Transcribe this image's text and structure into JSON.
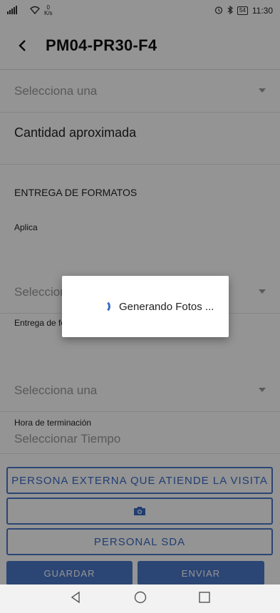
{
  "status_bar": {
    "speed_value": "0",
    "speed_unit": "K/s",
    "battery": "54",
    "time": "11:30"
  },
  "header": {
    "title": "PM04-PR30-F4"
  },
  "form": {
    "select_1": "Selecciona una",
    "cantidad_label": "Cantidad aproximada",
    "section_title": "ENTREGA DE FORMATOS",
    "aplica_label": "Aplica",
    "select_2": "Selecciona una",
    "entrega_label": "Entrega de formatos",
    "select_3": "Selecciona una",
    "hora_label": "Hora de terminación",
    "hora_placeholder": "Seleccionar Tiempo"
  },
  "buttons": {
    "persona_externa": "PERSONA EXTERNA QUE ATIENDE LA VISITA",
    "personal_sda": "PERSONAL SDA",
    "guardar": "GUARDAR",
    "enviar": "ENVIAR"
  },
  "dialog": {
    "message": "Generando Fotos ..."
  },
  "colors": {
    "accent": "#4a77c9",
    "overlay": "rgba(0,0,0,0.42)"
  },
  "icons": [
    "back-arrow-icon",
    "caret-down-icon",
    "camera-icon",
    "nav-back-icon",
    "nav-home-icon",
    "nav-recents-icon"
  ]
}
